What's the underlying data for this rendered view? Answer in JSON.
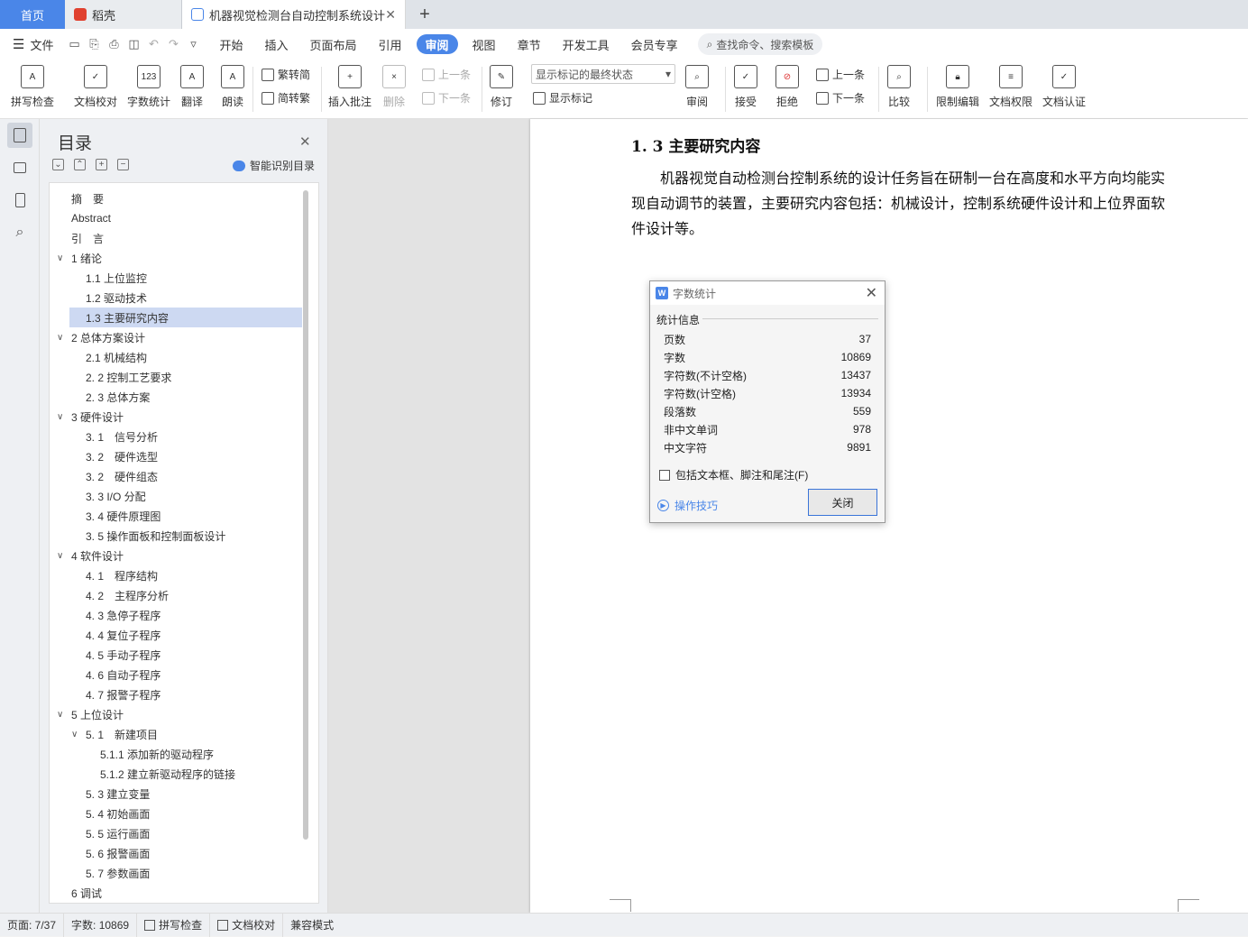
{
  "tabs": {
    "home": "首页",
    "daoke": "稻壳",
    "doc": "机器视觉检测台自动控制系统设计",
    "new": "+"
  },
  "menu": {
    "file": "文件",
    "items": [
      "开始",
      "插入",
      "页面布局",
      "引用",
      "审阅",
      "视图",
      "章节",
      "开发工具",
      "会员专享"
    ],
    "search": "查找命令、搜索模板"
  },
  "ribbon": {
    "spell": "拼写检查",
    "proof": "文档校对",
    "wordcount": "字数统计",
    "translate": "翻译",
    "read": "朗读",
    "t2s": "繁转简",
    "s2t": "简转繁",
    "insert_comment": "插入批注",
    "delete": "删除",
    "prev_comment": "上一条",
    "next_comment": "下一条",
    "revise": "修订",
    "markup_select": "显示标记的最终状态",
    "show_markup": "显示标记",
    "review": "审阅",
    "accept": "接受",
    "reject": "拒绝",
    "prev": "上一条",
    "next": "下一条",
    "compare": "比较",
    "restrict": "限制编辑",
    "permission": "文档权限",
    "certify": "文档认证"
  },
  "toc": {
    "title": "目录",
    "smart": "智能识别目录",
    "items": [
      "摘　要",
      "Abstract",
      "引　言",
      "1 绪论",
      "1.1 上位监控",
      "1.2 驱动技术",
      "1.3 主要研究内容",
      "2  总体方案设计",
      "2.1  机械结构",
      "2. 2 控制工艺要求",
      "2. 3 总体方案",
      "3 硬件设计",
      "3. 1　信号分析",
      "3. 2　硬件选型",
      "3. 2　硬件组态",
      "3. 3  I/O 分配",
      "3. 4  硬件原理图",
      "3. 5  操作面板和控制面板设计",
      "4  软件设计",
      "4. 1　程序结构",
      "4. 2　主程序分析",
      "4. 3  急停子程序",
      "4. 4  复位子程序",
      "4. 5  手动子程序",
      "4. 6  自动子程序",
      "4. 7  报警子程序",
      "5  上位设计",
      "5. 1　新建项目",
      "5.1.1  添加新的驱动程序",
      "5.1.2 建立新驱动程序的链接",
      "5. 3 建立变量",
      "5. 4  初始画面",
      "5. 5  运行画面",
      "5. 6  报警画面",
      "5. 7  参数画面",
      "6 调试"
    ]
  },
  "doc": {
    "heading": "1. 3 主要研究内容",
    "paragraph": "机器视觉自动检测台控制系统的设计任务旨在研制一台在高度和水平方向均能实现自动调节的装置，主要研究内容包括：机械设计，控制系统硬件设计和上位界面软件设计等。"
  },
  "dialog": {
    "title": "字数统计",
    "section": "统计信息",
    "rows": [
      {
        "k": "页数",
        "v": "37"
      },
      {
        "k": "字数",
        "v": "10869"
      },
      {
        "k": "字符数(不计空格)",
        "v": "13437"
      },
      {
        "k": "字符数(计空格)",
        "v": "13934"
      },
      {
        "k": "段落数",
        "v": "559"
      },
      {
        "k": "非中文单词",
        "v": "978"
      },
      {
        "k": "中文字符",
        "v": "9891"
      }
    ],
    "checkbox": "包括文本框、脚注和尾注(F)",
    "tips": "操作技巧",
    "close": "关闭"
  },
  "status": {
    "page": "页面: 7/37",
    "words": "字数: 10869",
    "spell": "拼写检查",
    "proof": "文档校对",
    "compat": "兼容模式"
  },
  "colors": {
    "accent": "#4a86e8",
    "selection": "#cdd9f2"
  }
}
